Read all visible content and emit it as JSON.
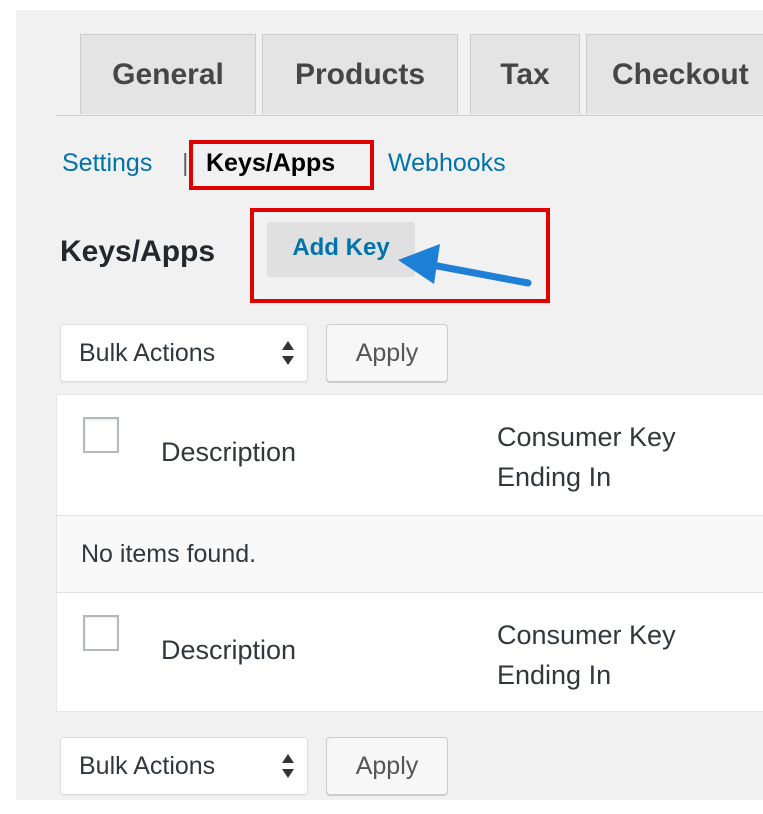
{
  "tabs": [
    {
      "label": "General"
    },
    {
      "label": "Products"
    },
    {
      "label": "Tax"
    },
    {
      "label": "Checkout"
    }
  ],
  "subnav": {
    "settings": "Settings",
    "separator": "|",
    "current": "Keys/Apps",
    "webhooks": "Webhooks"
  },
  "heading": {
    "title": "Keys/Apps",
    "add_key": "Add Key"
  },
  "bulk_top": {
    "select_value": "Bulk Actions",
    "apply": "Apply"
  },
  "table": {
    "col_description": "Description",
    "col_key_line1": "Consumer Key",
    "col_key_line2": "Ending In",
    "empty": "No items found."
  },
  "bulk_bottom": {
    "select_value": "Bulk Actions",
    "apply": "Apply"
  },
  "colors": {
    "link": "#0073aa",
    "annotation_red": "#e00000",
    "annotation_arrow": "#1e7fd6"
  },
  "icons": {
    "select_caret": "up-down-caret-icon",
    "arrow": "annotation-arrow-icon"
  }
}
